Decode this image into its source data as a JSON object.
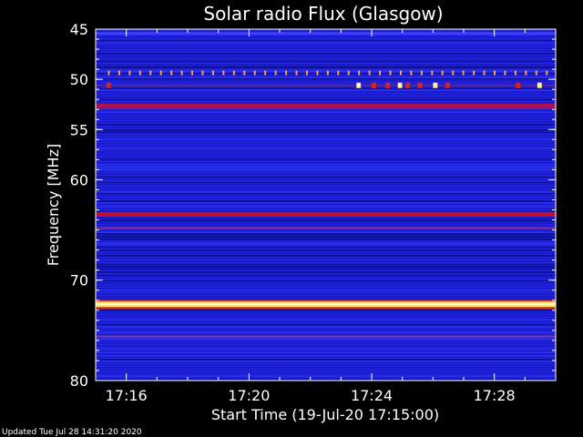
{
  "chart_data": {
    "type": "heatmap",
    "title": "Solar radio Flux (Glasgow)",
    "xlabel": "Start Time (19-Jul-20 17:15:00)",
    "ylabel": "Frequency [MHz]",
    "x_tick_labels": [
      "17:16",
      "17:20",
      "17:24",
      "17:28"
    ],
    "x_ticks_minutes": [
      1,
      5,
      9,
      13
    ],
    "x_range_minutes": [
      0,
      15
    ],
    "y_ticks": [
      45,
      50,
      55,
      60,
      70,
      80
    ],
    "y_range_mhz": [
      45,
      80
    ],
    "background_color": "#1a1ad0",
    "bands": [
      {
        "mhz": 49.4,
        "color": "#ffa04a",
        "style": "dotted"
      },
      {
        "mhz": 50.6,
        "color": "#cc1010",
        "style": "bursts"
      },
      {
        "mhz": 52.6,
        "color": "#b01050",
        "style": "solid"
      },
      {
        "mhz": 63.4,
        "color": "#c01030",
        "style": "solid"
      },
      {
        "mhz": 64.8,
        "color": "#8a2a90",
        "style": "faint"
      },
      {
        "mhz": 72.4,
        "color": "#fff8c0",
        "style": "bright"
      },
      {
        "mhz": 75.6,
        "color": "#7a3aa0",
        "style": "faint"
      }
    ],
    "bursts_minutes": [
      0.35,
      8.5,
      9.0,
      9.45,
      9.85,
      10.1,
      10.5,
      11.0,
      11.4,
      13.7,
      14.4
    ],
    "grid": false
  },
  "footer": "Updated Tue Jul 28 14:31:20 2020"
}
